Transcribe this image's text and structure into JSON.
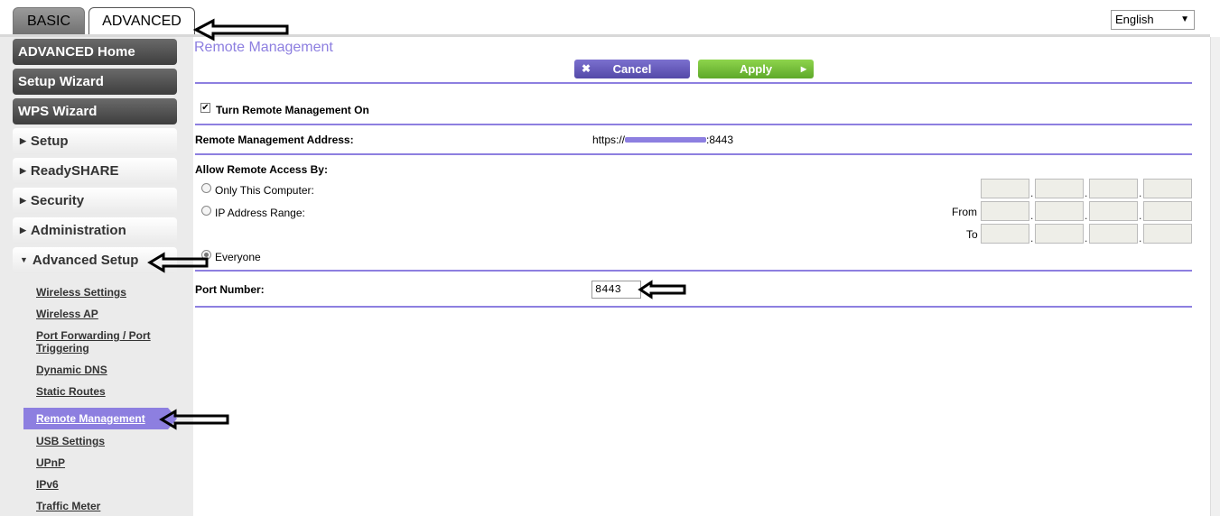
{
  "tabs": [
    {
      "label": "BASIC"
    },
    {
      "label": "ADVANCED"
    }
  ],
  "language": {
    "selected": "English"
  },
  "sidebar": {
    "main_buttons": [
      {
        "label": "ADVANCED Home"
      },
      {
        "label": "Setup Wizard"
      },
      {
        "label": "WPS Wizard"
      }
    ],
    "sections": [
      {
        "label": "Setup"
      },
      {
        "label": "ReadySHARE"
      },
      {
        "label": "Security"
      },
      {
        "label": "Administration"
      },
      {
        "label": "Advanced Setup"
      }
    ],
    "advanced_setup_links": [
      {
        "label": "Wireless Settings"
      },
      {
        "label": "Wireless AP"
      },
      {
        "label": "Port Forwarding / Port"
      },
      {
        "label": "Triggering"
      },
      {
        "label": "Dynamic DNS"
      },
      {
        "label": "Static Routes"
      },
      {
        "label": "Remote Management"
      },
      {
        "label": "USB Settings"
      },
      {
        "label": "UPnP"
      },
      {
        "label": "IPv6"
      },
      {
        "label": "Traffic Meter"
      }
    ]
  },
  "content": {
    "title": "Remote Management",
    "cancel_label": "Cancel",
    "apply_label": "Apply",
    "turn_on_label": "Turn Remote Management On",
    "turn_on_checked": true,
    "address_label": "Remote Management Address:",
    "address_prefix": "https://",
    "address_suffix": ":8443",
    "allow_label": "Allow Remote Access By:",
    "only_this_computer_label": "Only This Computer:",
    "ip_range_label": "IP Address Range:",
    "from_label": "From",
    "to_label": "To",
    "everyone_label": "Everyone",
    "everyone_selected": true,
    "port_label": "Port Number:",
    "port_value": "8443"
  },
  "colors": {
    "accent": "#8d7fe0",
    "apply_green": "#74c03a",
    "cancel_purple": "#6559bc"
  }
}
